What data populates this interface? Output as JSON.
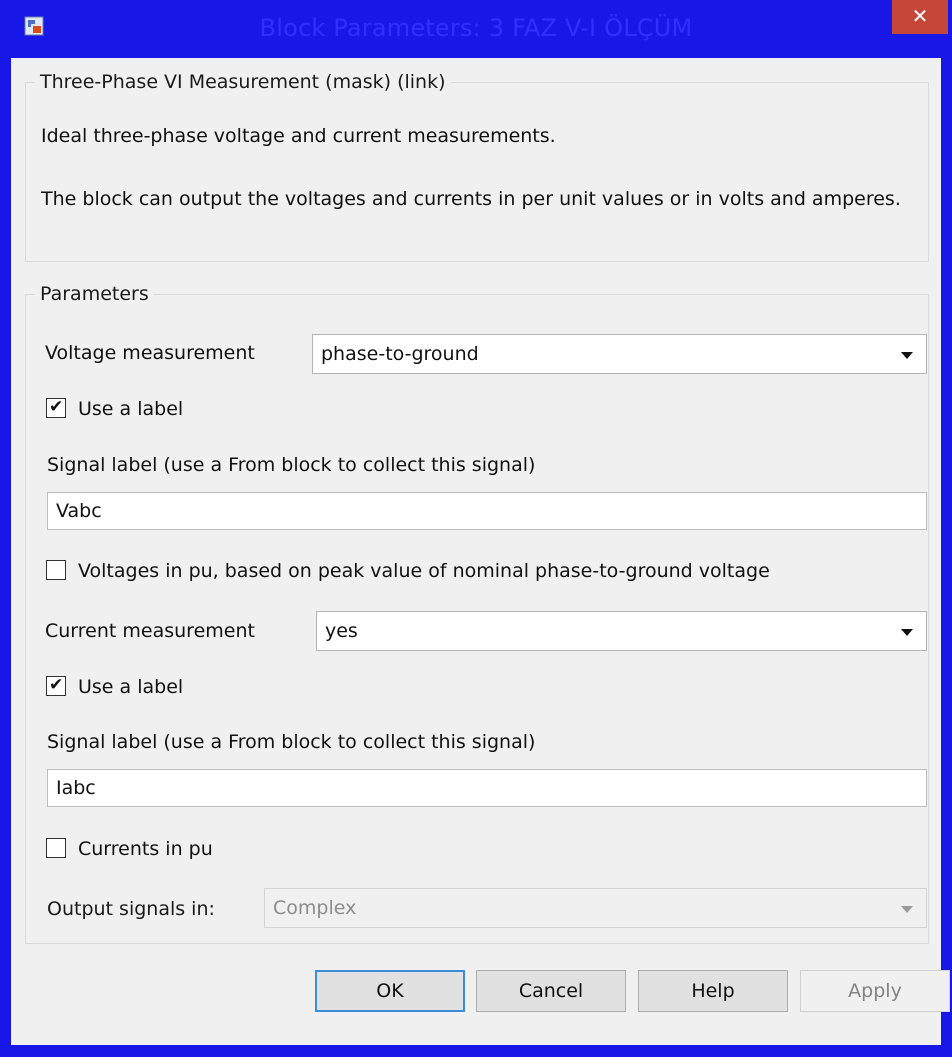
{
  "window": {
    "title": "Block Parameters: 3 FAZ V-I ÖLÇÜM",
    "close_glyph": "✕"
  },
  "description": {
    "group_title": "Three-Phase VI Measurement (mask) (link)",
    "line1": "Ideal three-phase voltage and current measurements.",
    "line2": "The block can output the voltages and currents in per unit values or in volts and amperes."
  },
  "parameters": {
    "group_title": "Parameters",
    "voltage_measurement": {
      "label": "Voltage measurement",
      "value": "phase-to-ground"
    },
    "voltage_use_label": {
      "label": "Use a label",
      "checked": true
    },
    "voltage_signal_label": {
      "label": "Signal label  (use a From block to collect this signal)",
      "value": "Vabc"
    },
    "voltages_in_pu": {
      "label": "Voltages in pu,  based on peak value of nominal phase-to-ground voltage",
      "checked": false
    },
    "current_measurement": {
      "label": "Current measurement",
      "value": "yes"
    },
    "current_use_label": {
      "label": "Use a label",
      "checked": true
    },
    "current_signal_label": {
      "label": "Signal label  (use a From block to collect this signal)",
      "value": "Iabc"
    },
    "currents_in_pu": {
      "label": "Currents in pu",
      "checked": false
    },
    "output_signals": {
      "label": "Output signals in:",
      "value": "Complex",
      "enabled": false
    }
  },
  "buttons": {
    "ok": "OK",
    "cancel": "Cancel",
    "help": "Help",
    "apply": "Apply"
  },
  "check_glyph": "✔",
  "colors": {
    "titlebar": "#1717e8",
    "close_button": "#c4473a",
    "dialog_bg": "#f0f0f0",
    "default_button_border": "#3c8cd8"
  },
  "icons": {
    "app": "simulink-block-icon",
    "close": "close-icon"
  }
}
